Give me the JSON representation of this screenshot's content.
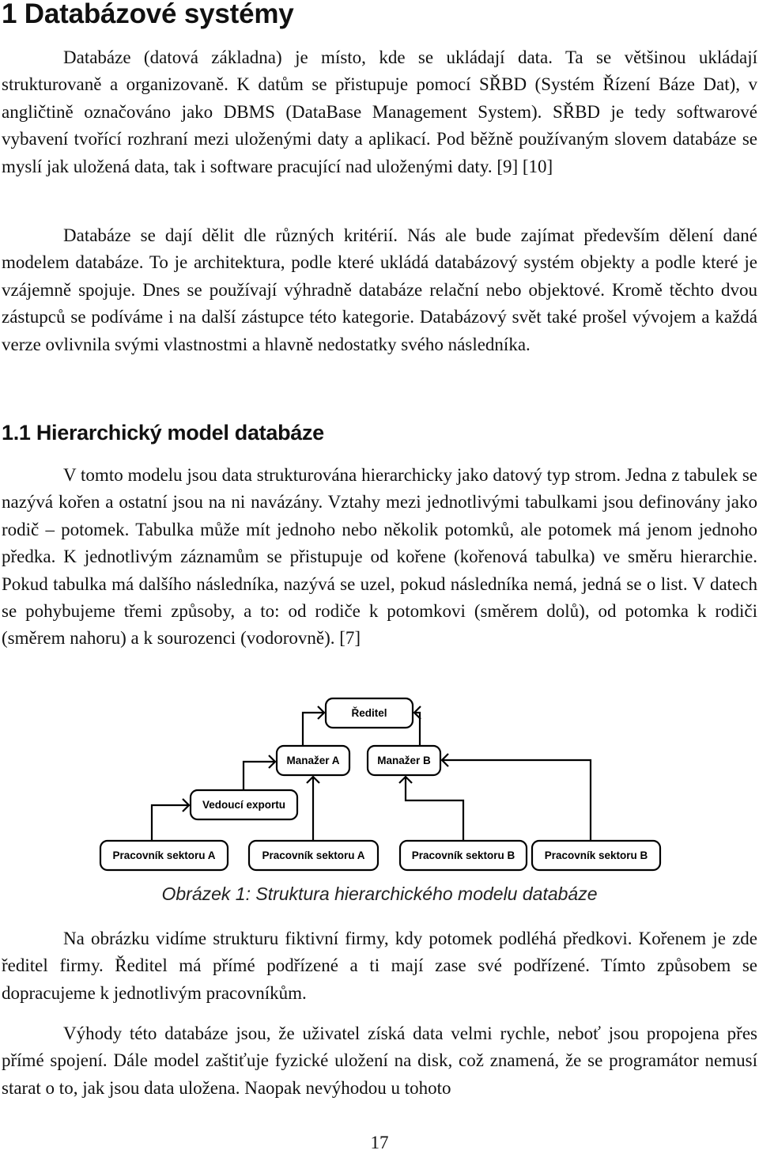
{
  "heading1": "1 Databázové systémy",
  "paragraphs_section1": [
    "Databáze (datová základna) je místo, kde se ukládají data. Ta se většinou ukládají strukturovaně a organizovaně. K datům se přistupuje pomocí SŘBD (Systém Řízení Báze Dat), v angličtině označováno jako DBMS (DataBase Management System). SŘBD je tedy softwarové vybavení tvořící rozhraní mezi uloženými daty a aplikací. Pod běžně používaným slovem databáze se myslí jak uložená data, tak i software pracující nad uloženými daty. [9] [10]",
    "Databáze se dají dělit dle různých kritérií. Nás ale bude zajímat především dělení dané modelem databáze. To je architektura, podle které ukládá databázový systém objekty a podle které je vzájemně spojuje. Dnes se používají výhradně databáze relační nebo objektové. Kromě těchto dvou zástupců se podíváme i na další zástupce této kategorie. Databázový svět také prošel vývojem a každá verze ovlivnila svými vlastnostmi a hlavně nedostatky svého následníka."
  ],
  "heading2": "1.1 Hierarchický model databáze",
  "paragraphs_section2": [
    "V tomto modelu jsou data strukturována hierarchicky jako datový typ strom. Jedna z tabulek se nazývá kořen a ostatní jsou na ni navázány. Vztahy mezi jednotlivými tabulkami jsou definovány jako rodič – potomek. Tabulka může mít jednoho nebo několik potomků, ale potomek má jenom jednoho předka. K jednotlivým záznamům se přistupuje od kořene (kořenová tabulka) ve směru hierarchie. Pokud tabulka má dalšího následníka, nazývá se uzel, pokud následníka nemá, jedná se o list. V datech se pohybujeme třemi způsoby, a to: od rodiče k potomkovi (směrem dolů), od potomka k rodiči (směrem nahoru) a k sourozenci (vodorovně). [7]",
    "Na obrázku vidíme strukturu fiktivní firmy, kdy potomek podléhá předkovi. Kořenem je zde ředitel firmy. Ředitel má přímé podřízené a ti mají zase své podřízené. Tímto způsobem se dopracujeme k jednotlivým pracovníkům.",
    "Výhody této databáze jsou, že uživatel získá data velmi rychle, neboť jsou propojena přes přímé spojení. Dále model zaštiťuje fyzické uložení na disk, což znamená, že se programátor nemusí starat o to, jak jsou data uložena. Naopak nevýhodou u tohoto"
  ],
  "figure": {
    "caption": "Obrázek 1: Struktura hierarchického modelu databáze",
    "nodes": [
      {
        "id": "reditel",
        "label": "Ředitel",
        "parent": null
      },
      {
        "id": "manazer_a",
        "label": "Manažer A",
        "parent": "reditel"
      },
      {
        "id": "manazer_b",
        "label": "Manažer B",
        "parent": "reditel"
      },
      {
        "id": "vedouci_exportu",
        "label": "Vedoucí exportu",
        "parent": "manazer_a"
      },
      {
        "id": "pracovnik_a1",
        "label": "Pracovník sektoru A",
        "parent": "vedouci_exportu"
      },
      {
        "id": "pracovnik_a2",
        "label": "Pracovník sektoru A",
        "parent": "manazer_a"
      },
      {
        "id": "pracovnik_b1",
        "label": "Pracovník sektoru B",
        "parent": "manazer_b"
      },
      {
        "id": "pracovnik_b2",
        "label": "Pracovník sektoru B",
        "parent": "manazer_b"
      }
    ]
  },
  "page_number": "17"
}
